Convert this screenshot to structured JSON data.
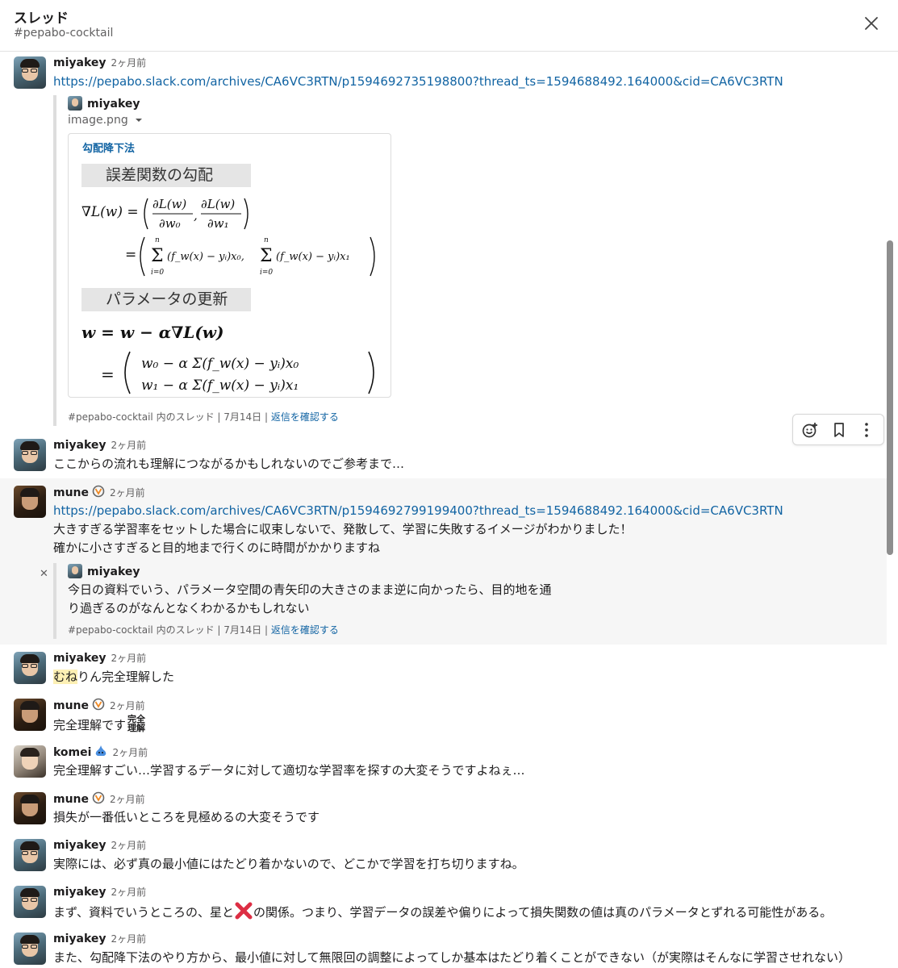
{
  "header": {
    "title": "スレッド",
    "channel": "#pepabo-cocktail"
  },
  "messages": [
    {
      "user": "miyakey",
      "time": "2ヶ月前",
      "link": "https://pepabo.slack.com/archives/CA6VC3RTN/p1594692735198800?thread_ts=1594688492.164000&cid=CA6VC3RTN",
      "quote": {
        "user": "miyakey",
        "file": "image.png",
        "image_title": "勾配降下法",
        "math_head_1": "誤差関数の勾配",
        "math_head_2": "パラメータの更新",
        "footer_channel": "#pepabo-cocktail 内のスレッド",
        "footer_date": "7月14日",
        "footer_link": "返信を確認する"
      }
    },
    {
      "user": "miyakey",
      "time": "2ヶ月前",
      "text": "ここからの流れも理解につながるかもしれないのでご参考まで…"
    },
    {
      "user": "mune",
      "time": "2ヶ月前",
      "link": "https://pepabo.slack.com/archives/CA6VC3RTN/p1594692799199400?thread_ts=1594688492.164000&cid=CA6VC3RTN",
      "line1": "大きすぎる学習率をセットした場合に収束しないで、発散して、学習に失敗するイメージがわかりました！",
      "line2": "確かに小さすぎると目的地まで行くのに時間がかかりますね",
      "quote": {
        "user": "miyakey",
        "line1": "今日の資料でいう、パラメータ空間の青矢印の大きさのまま逆に向かったら、目的地を通",
        "line2": "り過ぎるのがなんとなくわかるかもしれない",
        "footer_channel": "#pepabo-cocktail 内のスレッド",
        "footer_date": "7月14日",
        "footer_link": "返信を確認する"
      }
    },
    {
      "user": "miyakey",
      "time": "2ヶ月前",
      "highlight": "むね",
      "text": "りん完全理解した"
    },
    {
      "user": "mune",
      "time": "2ヶ月前",
      "text": "完全理解です",
      "stamp": "完全理解"
    },
    {
      "user": "komei",
      "time": "2ヶ月前",
      "text": "完全理解すごい…学習するデータに対して適切な学習率を探すの大変そうですよねぇ…"
    },
    {
      "user": "mune",
      "time": "2ヶ月前",
      "text": "損失が一番低いところを見極めるの大変そうです"
    },
    {
      "user": "miyakey",
      "time": "2ヶ月前",
      "text": "実際には、必ず真の最小値にはたどり着かないので、どこかで学習を打ち切りますね。"
    },
    {
      "user": "miyakey",
      "time": "2ヶ月前",
      "text_before": "まず、資料でいうところの、星と",
      "text_after": "の関係。つまり、学習データの誤差や偏りによって損失関数の値は真のパラメータとずれる可能性がある。"
    },
    {
      "user": "miyakey",
      "time": "2ヶ月前",
      "text": "また、勾配降下法のやり方から、最小値に対して無限回の調整によってしか基本はたどり着くことができない（が実際はそんなに学習させれない）"
    }
  ],
  "colors": {
    "link": "#1264a3",
    "highlight": "#fdf0b4",
    "hover_bg": "#f6f6f6"
  },
  "icons": [
    "close-icon",
    "add-reaction-icon",
    "bookmark-icon",
    "more-icon",
    "overwatch-icon",
    "slime-icon",
    "cross-mark-icon"
  ]
}
